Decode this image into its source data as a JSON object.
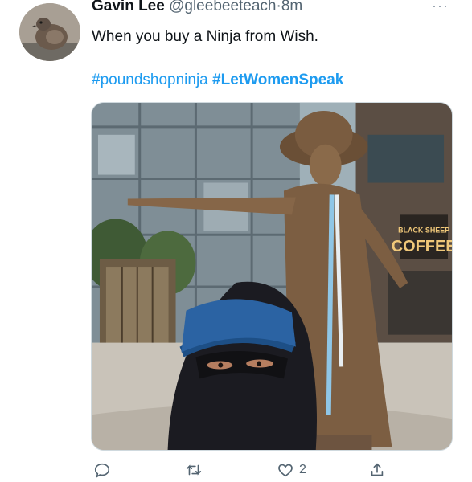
{
  "tweet": {
    "author_name": "Gavin Lee",
    "author_handle": "@gleebeeteach",
    "separator": "·",
    "time": "8m",
    "text": "When you buy a Ninja from Wish.",
    "hashtags": [
      "#poundshopninja",
      "#LetWomenSpeak"
    ],
    "media": {
      "sign_line1": "BLACK SHEEP",
      "sign_line2": "COFFEE"
    },
    "actions": {
      "reply_count": "",
      "retweet_count": "",
      "like_count": "2",
      "share_count": ""
    }
  },
  "icons": {
    "more": "more-horizontal-icon",
    "reply": "reply-icon",
    "retweet": "retweet-icon",
    "like": "heart-icon",
    "share": "share-icon"
  },
  "colors": {
    "link": "#1d9bf0",
    "muted": "#536471",
    "text": "#0f1419"
  }
}
